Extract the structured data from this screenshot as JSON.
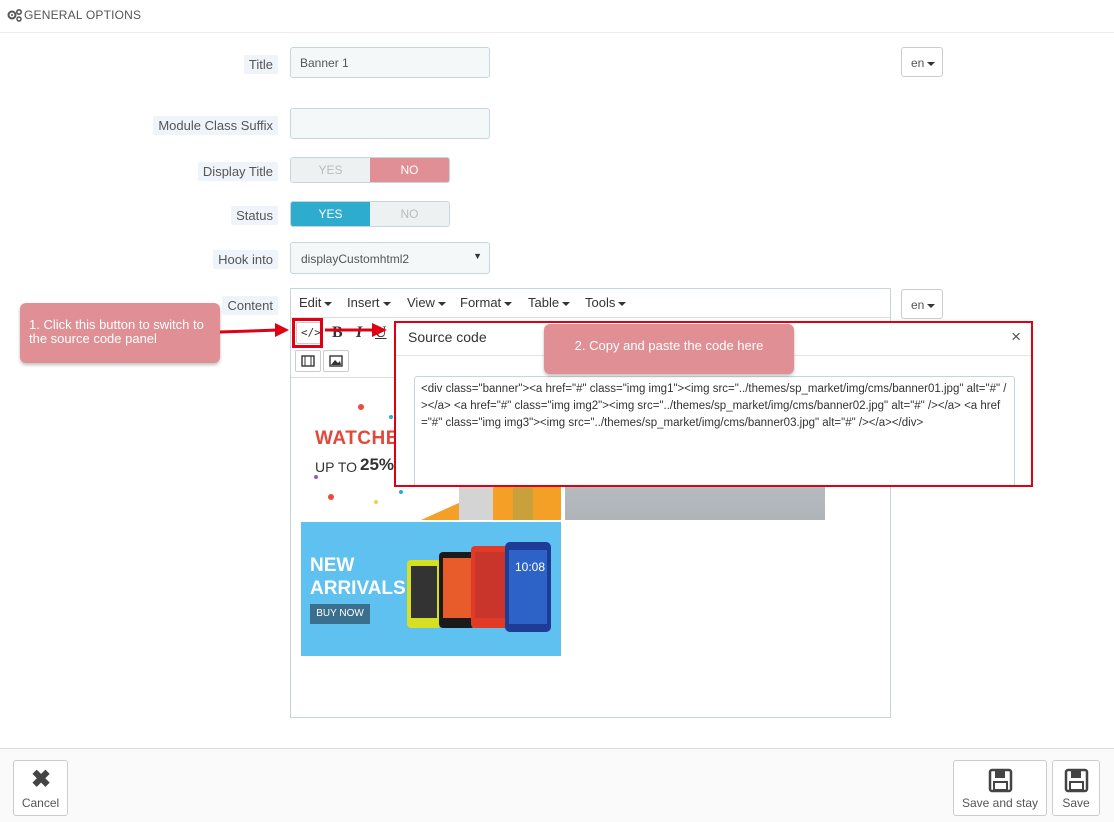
{
  "panel": {
    "title": "GENERAL OPTIONS"
  },
  "form": {
    "title_label": "Title",
    "title_value": "Banner 1",
    "lang_label": "en",
    "suffix_label": "Module Class Suffix",
    "suffix_value": "",
    "display_title_label": "Display Title",
    "display_title_yes": "YES",
    "display_title_no": "NO",
    "status_label": "Status",
    "status_yes": "YES",
    "status_no": "NO",
    "hook_label": "Hook into",
    "hook_value": "displayCustomhtml2",
    "content_label": "Content",
    "content_lang": "en"
  },
  "editor": {
    "menu": [
      "Edit",
      "Insert",
      "View",
      "Format",
      "Table",
      "Tools"
    ],
    "toolbar_icons": [
      "source-code-icon",
      "bold-icon",
      "italic-icon",
      "underline-icon",
      "media-icon",
      "image-icon"
    ],
    "bold": "B",
    "italic": "I",
    "underline": "U"
  },
  "banners": {
    "b1_title": "WATCHE",
    "b1_prefix": "UP TO",
    "b1_percent": "25%",
    "b3_line1": "NEW",
    "b3_line2": "ARRIVALS",
    "b3_button": "BUY NOW",
    "phone_time": "10:08"
  },
  "modal": {
    "title": "Source code",
    "close": "×",
    "code": "<div class=\"banner\"><a href=\"#\" class=\"img img1\"><img src=\"../themes/sp_market/img/cms/banner01.jpg\" alt=\"#\" /></a> <a href=\"#\" class=\"img img2\"><img src=\"../themes/sp_market/img/cms/banner02.jpg\" alt=\"#\" /></a> <a href=\"#\" class=\"img img3\"><img src=\"../themes/sp_market/img/cms/banner03.jpg\" alt=\"#\" /></a></div>"
  },
  "callouts": {
    "step1": "1. Click this button to switch to the source code panel",
    "step2": "2. Copy and paste the code here"
  },
  "footer": {
    "cancel": "Cancel",
    "save_and_stay": "Save and stay",
    "save": "Save"
  },
  "colors": {
    "annotation_red": "#e00014",
    "callout_pink": "#e08f95",
    "toggle_blue": "#2eacce"
  }
}
